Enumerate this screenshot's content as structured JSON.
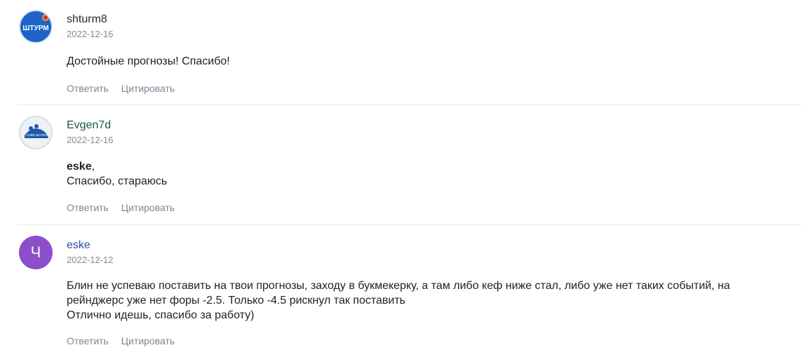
{
  "comments": [
    {
      "author": "shturm8",
      "author_color": "#2b2b2b",
      "date": "2022-12-16",
      "avatar_text": "ШТУРМ",
      "text_lines": [
        "Достойные прогнозы! Спасибо!"
      ]
    },
    {
      "author": "Evgen7d",
      "author_color": "#1a5a3a",
      "date": "2022-12-16",
      "avatar_text": "СОВЕ БЕТИНГ",
      "mention": "eske",
      "text_lines": [
        "Спасибо, стараюсь"
      ]
    },
    {
      "author": "eske",
      "author_color": "#2a4ea0",
      "date": "2022-12-12",
      "avatar_letter": "Ч",
      "avatar_color": "#8a4fc9",
      "text_lines": [
        "Блин не успеваю поставить на твои прогнозы, заходу в букмекерку, а там либо кеф ниже стал, либо уже нет таких событий, на",
        "рейнджерс уже нет форы -2.5. Только -4.5 рискнул так поставить",
        "Отлично идешь, спасибо за работу)"
      ]
    }
  ],
  "actions": {
    "reply_label": "Ответить",
    "quote_label": "Цитировать"
  }
}
